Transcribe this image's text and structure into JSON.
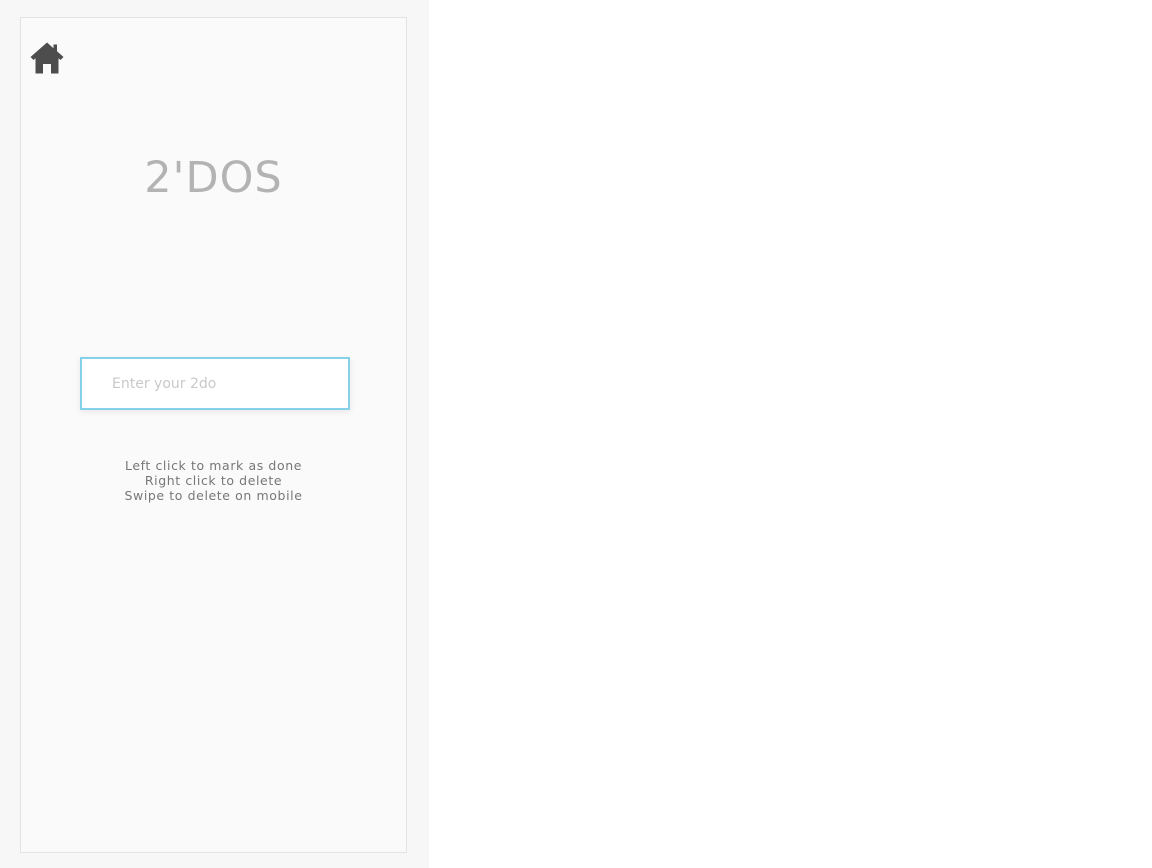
{
  "header": {
    "home_icon": "home-icon"
  },
  "app": {
    "title": "2'DOS"
  },
  "todo_input": {
    "placeholder": "Enter your 2do",
    "value": ""
  },
  "instructions": {
    "lines": [
      "Left click to mark as done",
      "Right click to delete",
      "Swipe to delete on mobile"
    ]
  },
  "colors": {
    "title": "#b3b3b3",
    "input_border": "#86d0e8",
    "icon": "#4d4d4d",
    "instruction_text": "#777777"
  }
}
